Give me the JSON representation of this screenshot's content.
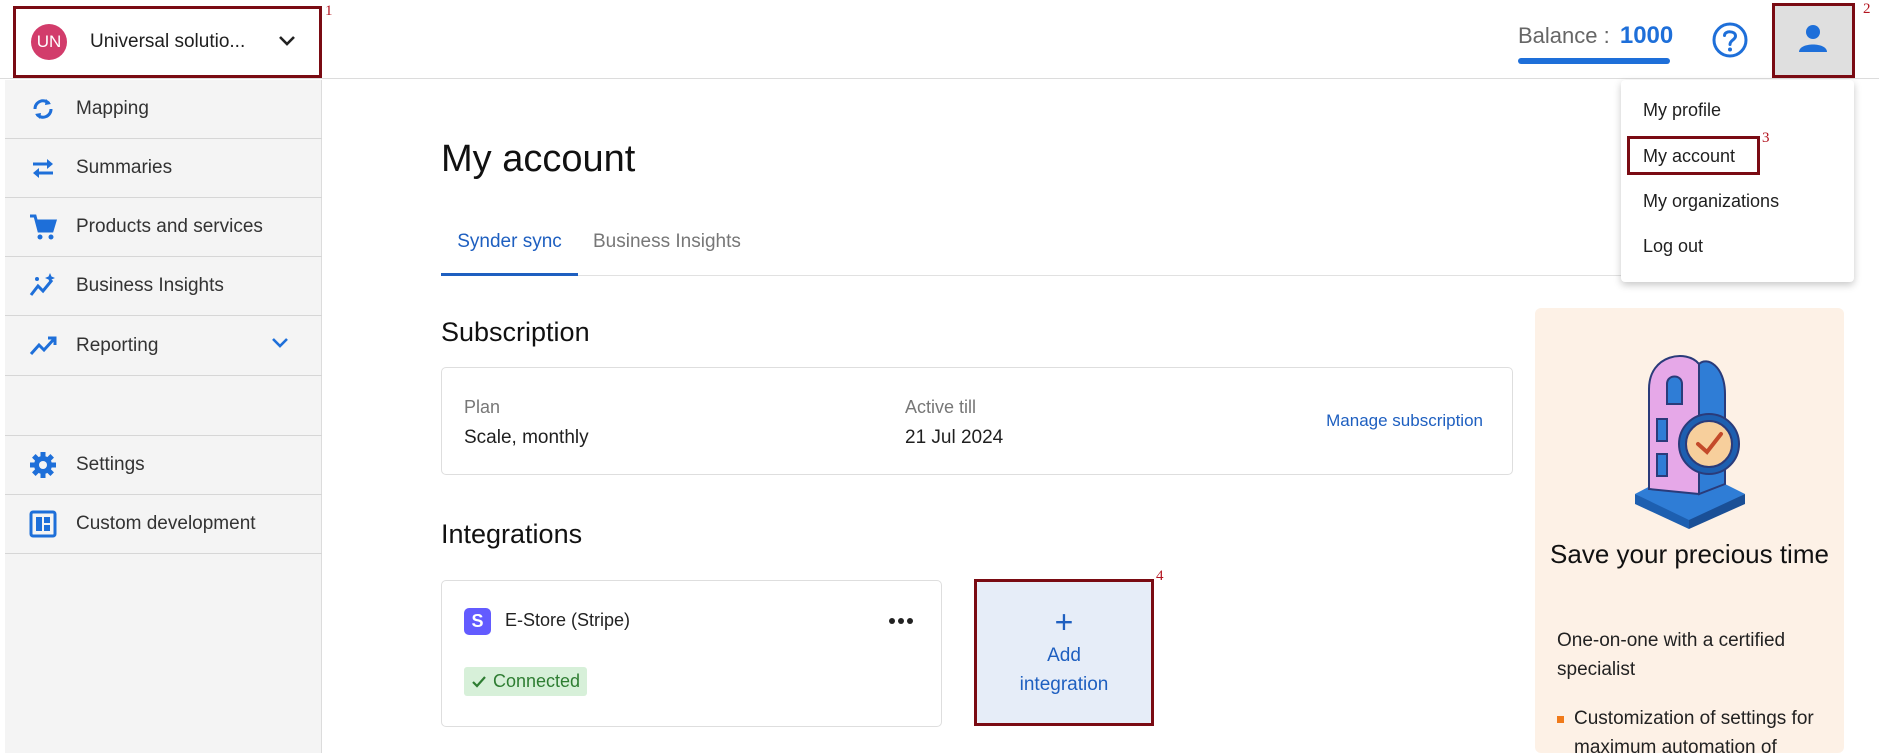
{
  "header": {
    "org_initials": "UN",
    "org_name": "Universal solutio...",
    "balance_label": "Balance :",
    "balance_value": "1000"
  },
  "sidebar": {
    "items": [
      {
        "label": "Mapping",
        "icon": "sync-icon"
      },
      {
        "label": "Summaries",
        "icon": "swap-arrows-icon"
      },
      {
        "label": "Products and services",
        "icon": "cart-icon"
      },
      {
        "label": "Business Insights",
        "icon": "insights-icon"
      },
      {
        "label": "Reporting",
        "icon": "trending-icon"
      },
      {
        "label": "Settings",
        "icon": "gear-icon"
      },
      {
        "label": "Custom development",
        "icon": "dashboard-icon"
      }
    ]
  },
  "main": {
    "title": "My account",
    "tabs": [
      {
        "label": "Synder sync",
        "active": true
      },
      {
        "label": "Business Insights",
        "active": false
      }
    ],
    "subscription": {
      "section_title": "Subscription",
      "plan_label": "Plan",
      "plan_value": "Scale, monthly",
      "active_label": "Active till",
      "active_value": "21 Jul 2024",
      "manage_link": "Manage subscription"
    },
    "integrations": {
      "section_title": "Integrations",
      "items": [
        {
          "name": "E-Store (Stripe)",
          "status": "Connected",
          "logo_letter": "S"
        }
      ],
      "add_plus": "+",
      "add_line1": "Add",
      "add_line2": "integration"
    }
  },
  "promo": {
    "title": "Save your precious time",
    "subtitle": "One-on-one with a certified specialist",
    "bullet": "Customization of settings for maximum automation of"
  },
  "user_menu": {
    "items": [
      "My profile",
      "My account",
      "My organizations",
      "Log out"
    ]
  },
  "annotations": {
    "n1": "1",
    "n2": "2",
    "n3": "3",
    "n4": "4"
  },
  "colors": {
    "accent": "#1e6fd9",
    "link": "#1e5fc0",
    "highlight": "#7a0b13",
    "avatar": "#d23c6b",
    "stripe": "#635bff",
    "connected_bg": "#d7f0d9",
    "promo_bg": "#fdf1e6"
  }
}
